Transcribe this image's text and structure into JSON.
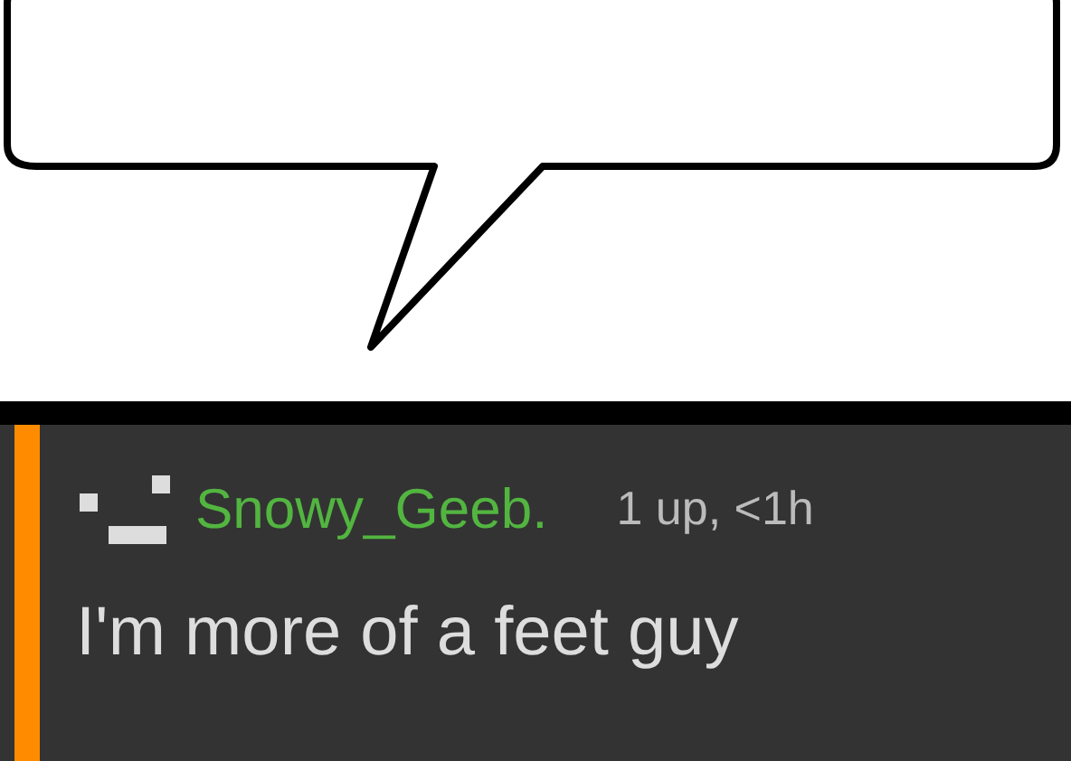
{
  "comment": {
    "username": "Snowy_Geeb.",
    "meta": "1 up, <1h",
    "text": "I'm more of a feet guy"
  }
}
